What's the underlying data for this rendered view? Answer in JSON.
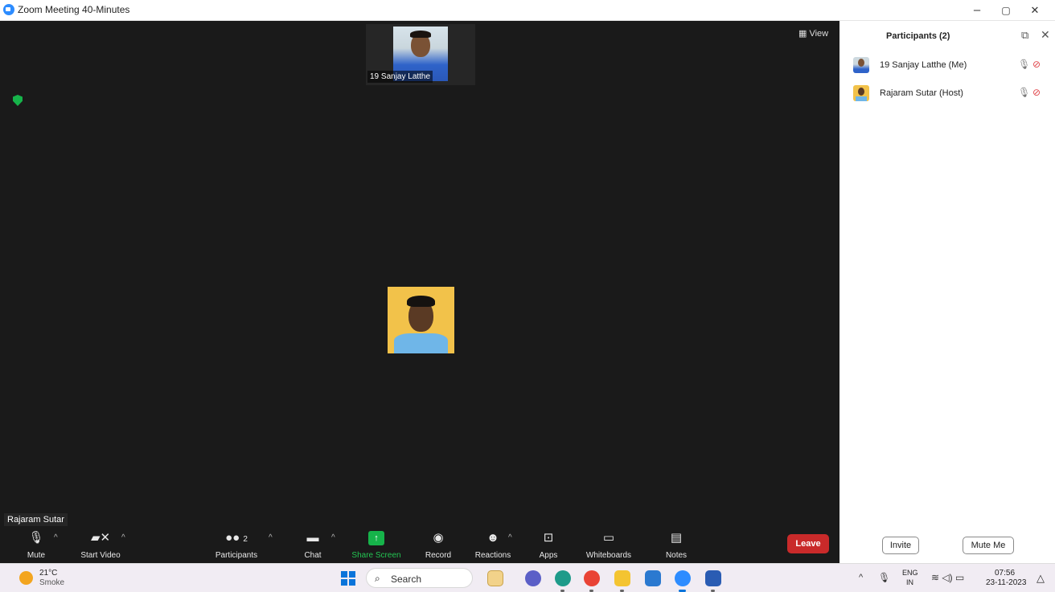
{
  "window": {
    "title": "Zoom Meeting 40-Minutes",
    "controls": [
      "–",
      "▢",
      "✕"
    ]
  },
  "meeting": {
    "view_label": "View",
    "top_tile_name": "19 Sanjay Latthe",
    "active_speaker": "Rajaram Sutar"
  },
  "toolbar": {
    "mute": "Mute",
    "start_video": "Start Video",
    "participants": "Participants",
    "participant_count": "2",
    "chat": "Chat",
    "share_screen": "Share Screen",
    "record": "Record",
    "reactions": "Reactions",
    "apps": "Apps",
    "whiteboards": "Whiteboards",
    "notes": "Notes",
    "leave": "Leave"
  },
  "panel": {
    "title": "Participants (2)",
    "participants": [
      {
        "name": "19 Sanjay Latthe (Me)",
        "mic": "muted",
        "video": "off"
      },
      {
        "name": "Rajaram Sutar (Host)",
        "mic": "muted",
        "video": "off"
      }
    ],
    "invite": "Invite",
    "mute_me": "Mute Me"
  },
  "taskbar": {
    "weather_temp": "21°C",
    "weather_desc": "Smoke",
    "search": "Search",
    "lang_top": "ENG",
    "lang_bottom": "IN",
    "time": "07:56",
    "date": "23-11-2023"
  },
  "colors": {
    "meeting_bg": "#1a1a1a",
    "leave_red": "#c92a2a",
    "share_green": "#16b34a",
    "zoom_blue": "#2d8cff",
    "cam_off_red": "#e0454a"
  }
}
